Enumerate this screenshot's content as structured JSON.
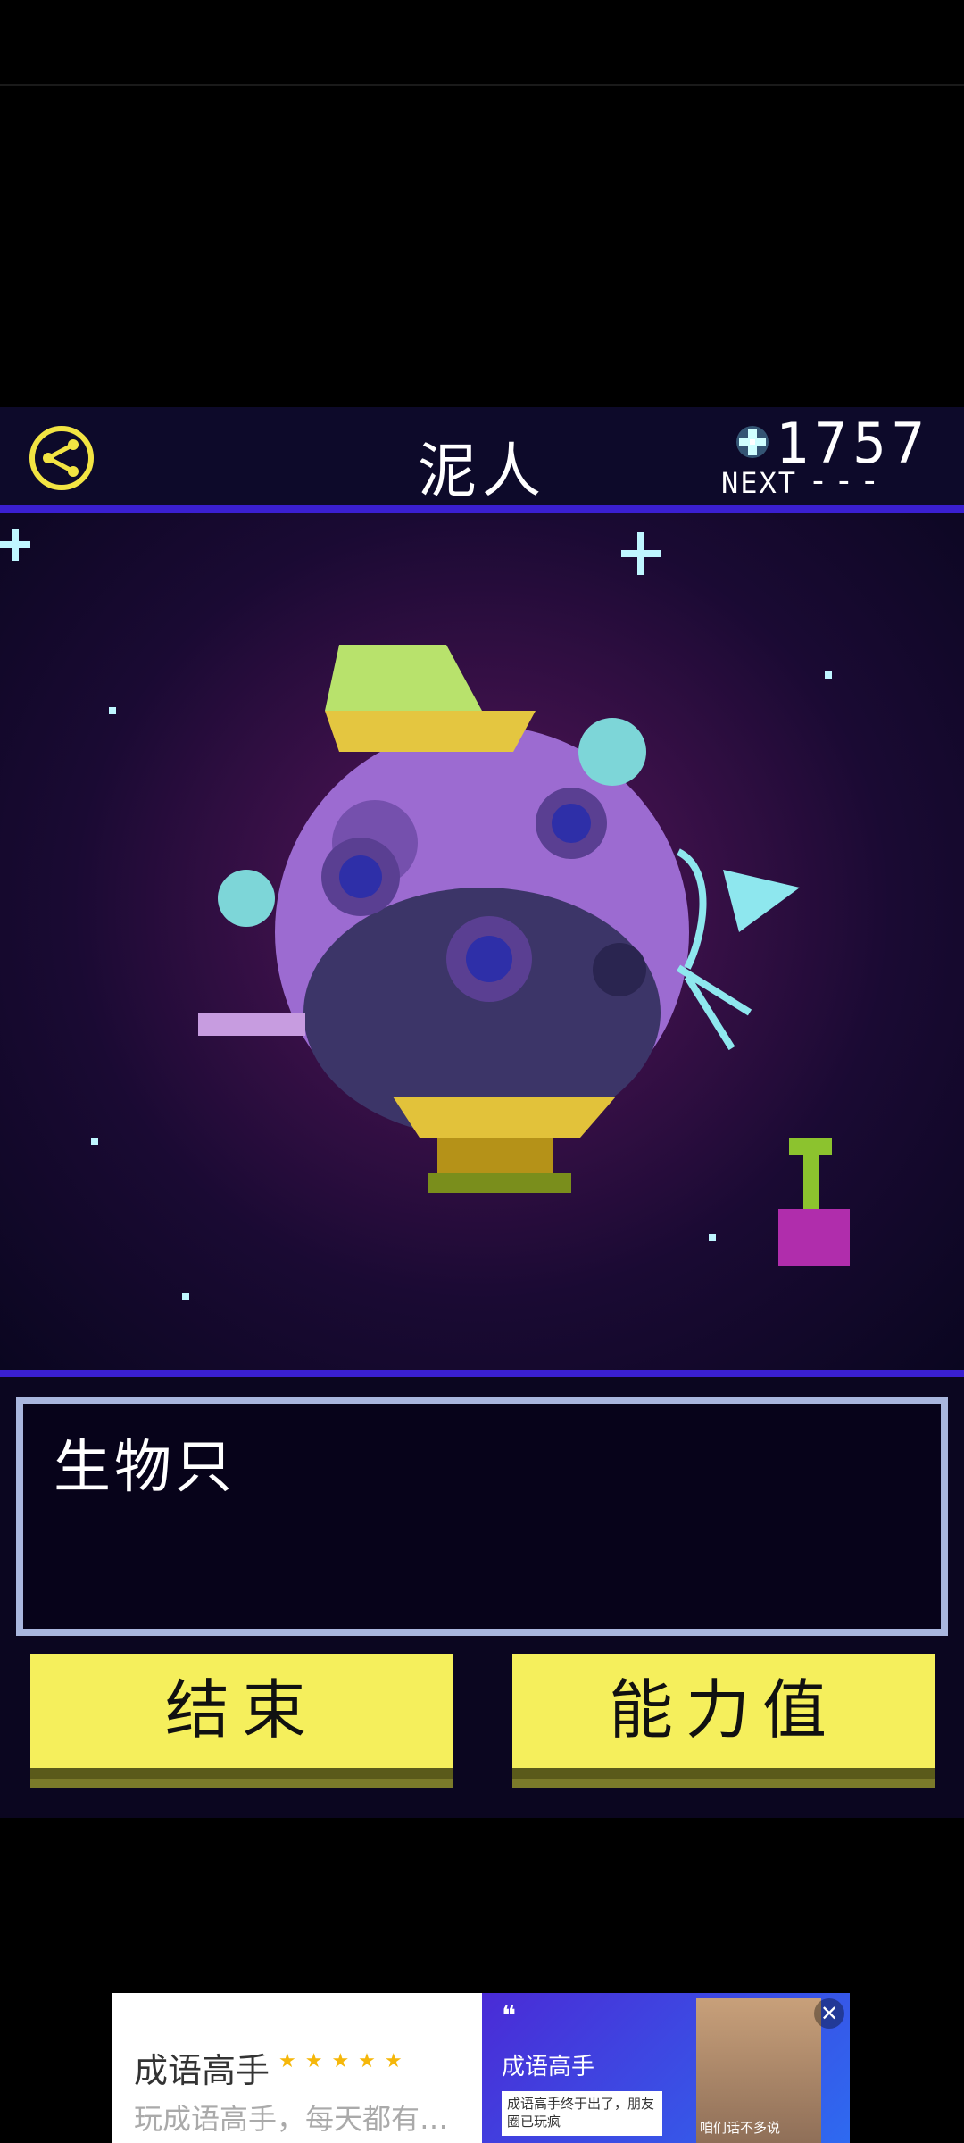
{
  "header": {
    "planet_name": "泥人",
    "gem_count": "1757",
    "next_label": "NEXT",
    "next_value": "---"
  },
  "message": {
    "text": "生物只"
  },
  "buttons": {
    "end_label": "结束",
    "stats_label": "能力值"
  },
  "ad": {
    "title": "成语高手",
    "stars": "★★★★★",
    "subtitle": "玩成语高手，每天都有…",
    "quote_mark": "❝",
    "right_title": "成语高手",
    "right_box_text": "成语高手终于出了，朋友圈已玩疯",
    "image_caption": "咱们话不多说",
    "close_symbol": "✕"
  },
  "colors": {
    "accent_yellow": "#f5ef5c",
    "bar_blue": "#3a1fd1",
    "box_border": "#a9b6de"
  },
  "icons": {
    "share": "share-icon",
    "gem": "sparkle-gem-icon",
    "planet": "planet-creature-icon"
  }
}
